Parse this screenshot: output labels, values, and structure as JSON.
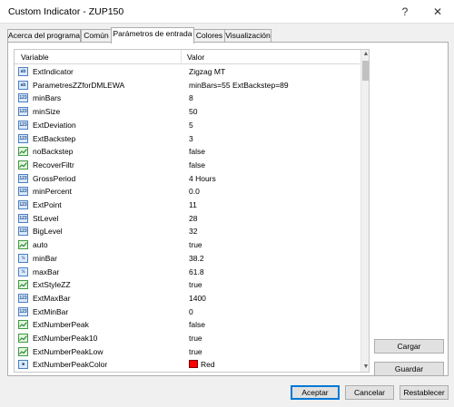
{
  "window": {
    "title": "Custom Indicator - ZUP150",
    "help_label": "?",
    "close_label": "✕"
  },
  "tabs": [
    {
      "label": "Acerca del programa"
    },
    {
      "label": "Común"
    },
    {
      "label": "Parámetros de entrada"
    },
    {
      "label": "Colores"
    },
    {
      "label": "Visualización"
    }
  ],
  "grid": {
    "columns": [
      "Variable",
      "Valor"
    ],
    "rows": [
      {
        "icon": "abc",
        "name": "ExtIndicator",
        "value": "Zigzag MT"
      },
      {
        "icon": "abc",
        "name": "ParametresZZforDMLEWA",
        "value": "minBars=55  ExtBackstep=89"
      },
      {
        "icon": "123",
        "name": "minBars",
        "value": "8"
      },
      {
        "icon": "123",
        "name": "minSize",
        "value": "50"
      },
      {
        "icon": "123",
        "name": "ExtDeviation",
        "value": "5"
      },
      {
        "icon": "123",
        "name": "ExtBackstep",
        "value": "3"
      },
      {
        "icon": "bool",
        "name": "noBackstep",
        "value": "false"
      },
      {
        "icon": "bool",
        "name": "RecoverFiltr",
        "value": "false"
      },
      {
        "icon": "123",
        "name": "GrossPeriod",
        "value": "4 Hours"
      },
      {
        "icon": "123",
        "name": "minPercent",
        "value": "0.0"
      },
      {
        "icon": "123",
        "name": "ExtPoint",
        "value": "11"
      },
      {
        "icon": "123",
        "name": "StLevel",
        "value": "28"
      },
      {
        "icon": "123",
        "name": "BigLevel",
        "value": "32"
      },
      {
        "icon": "bool",
        "name": "auto",
        "value": "true"
      },
      {
        "icon": "v2",
        "name": "minBar",
        "value": "38.2"
      },
      {
        "icon": "v2",
        "name": "maxBar",
        "value": "61.8"
      },
      {
        "icon": "bool",
        "name": "ExtStyleZZ",
        "value": "true"
      },
      {
        "icon": "123",
        "name": "ExtMaxBar",
        "value": "1400"
      },
      {
        "icon": "123",
        "name": "ExtMinBar",
        "value": "0"
      },
      {
        "icon": "bool",
        "name": "ExtNumberPeak",
        "value": "false"
      },
      {
        "icon": "bool",
        "name": "ExtNumberPeak10",
        "value": "true"
      },
      {
        "icon": "bool",
        "name": "ExtNumberPeakLow",
        "value": "true"
      },
      {
        "icon": "color",
        "name": "ExtNumberPeakColor",
        "value": "Red",
        "swatch": "#ff0000"
      }
    ]
  },
  "side_buttons": {
    "load": "Cargar",
    "save": "Guardar"
  },
  "footer": {
    "accept": "Aceptar",
    "cancel": "Cancelar",
    "reset": "Restablecer"
  }
}
